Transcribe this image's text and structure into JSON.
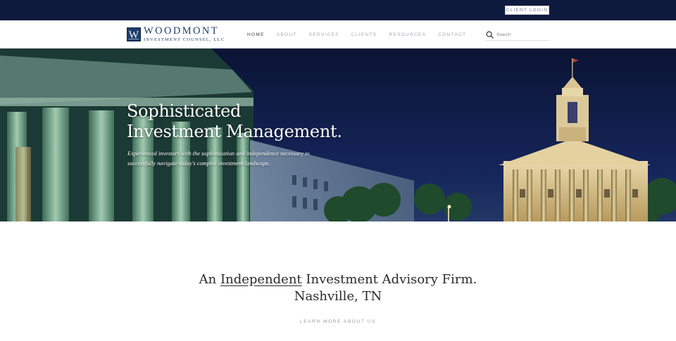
{
  "topbar": {
    "client_login": "CLIENT LOGIN"
  },
  "logo": {
    "mark": "W",
    "name": "WOODMONT",
    "subtitle": "INVESTMENT COUNSEL, LLC"
  },
  "nav": {
    "items": [
      {
        "label": "HOME",
        "active": true
      },
      {
        "label": "ABOUT",
        "active": false
      },
      {
        "label": "SERVICES",
        "active": false
      },
      {
        "label": "CLIENTS",
        "active": false
      },
      {
        "label": "RESOURCES",
        "active": false
      },
      {
        "label": "CONTACT",
        "active": false
      }
    ]
  },
  "search": {
    "placeholder": "Search",
    "icon": "search-icon"
  },
  "hero": {
    "title_line1": "Sophisticated",
    "title_line2": "Investment Management.",
    "subtitle": "Experienced investors with the sophistication and independence necessary to successfully navigate today's complex investment landscape."
  },
  "intro": {
    "line1_prefix": "An ",
    "line1_emphasis": "Independent",
    "line1_suffix": " Investment Advisory Firm.",
    "line2": "Nashville, TN",
    "cta": "LEARN MORE ABOUT US"
  },
  "colors": {
    "topbar": "#0e1a3d",
    "brand": "#1e3d6a",
    "nav_active": "#3a4052",
    "nav_inactive": "#a3a7b3"
  }
}
